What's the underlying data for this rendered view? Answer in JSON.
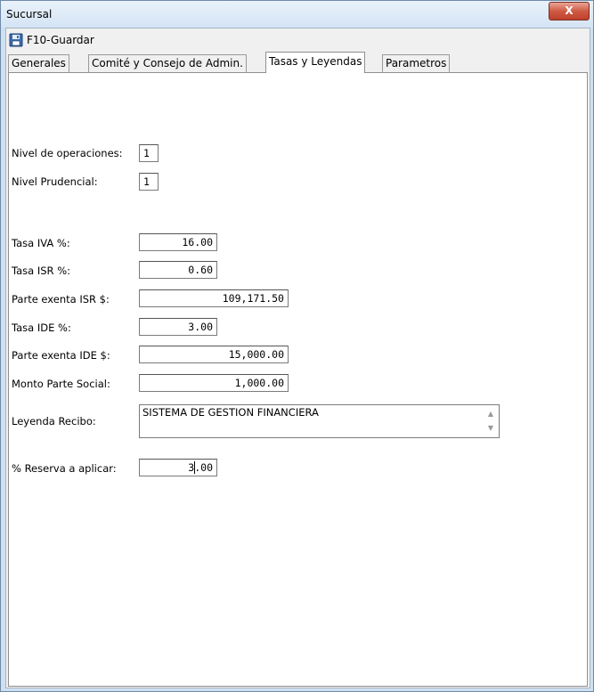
{
  "window": {
    "title": "Sucursal",
    "close_glyph": "X"
  },
  "toolbar": {
    "save_label": "F10-Guardar",
    "save_icon": "floppy-disk-icon"
  },
  "tabs": [
    {
      "label": "Generales"
    },
    {
      "label": "Comité y Consejo de Admin."
    },
    {
      "label": "Tasas y Leyendas"
    },
    {
      "label": "Parametros"
    }
  ],
  "active_tab": "Tasas y Leyendas",
  "form": {
    "nivel_operaciones": {
      "label": "Nivel de operaciones:",
      "value": "1"
    },
    "nivel_prudencial": {
      "label": "Nivel Prudencial:",
      "value": "1"
    },
    "tasa_iva": {
      "label": "Tasa IVA %:",
      "value": "16.00"
    },
    "tasa_isr": {
      "label": "Tasa ISR %:",
      "value": "0.60"
    },
    "parte_exenta_isr": {
      "label": "Parte exenta ISR $:",
      "value": "109,171.50"
    },
    "tasa_ide": {
      "label": "Tasa IDE %:",
      "value": "3.00"
    },
    "parte_exenta_ide": {
      "label": "Parte exenta IDE $:",
      "value": "15,000.00"
    },
    "monto_parte_social": {
      "label": "Monto Parte Social:",
      "value": "1,000.00"
    },
    "leyenda_recibo": {
      "label": "Leyenda Recibo:",
      "value": "SISTEMA DE GESTION FINANCIERA"
    },
    "reserva": {
      "label": "% Reserva a aplicar:",
      "value_before_caret": "3",
      "value_after_caret": ".00"
    }
  }
}
